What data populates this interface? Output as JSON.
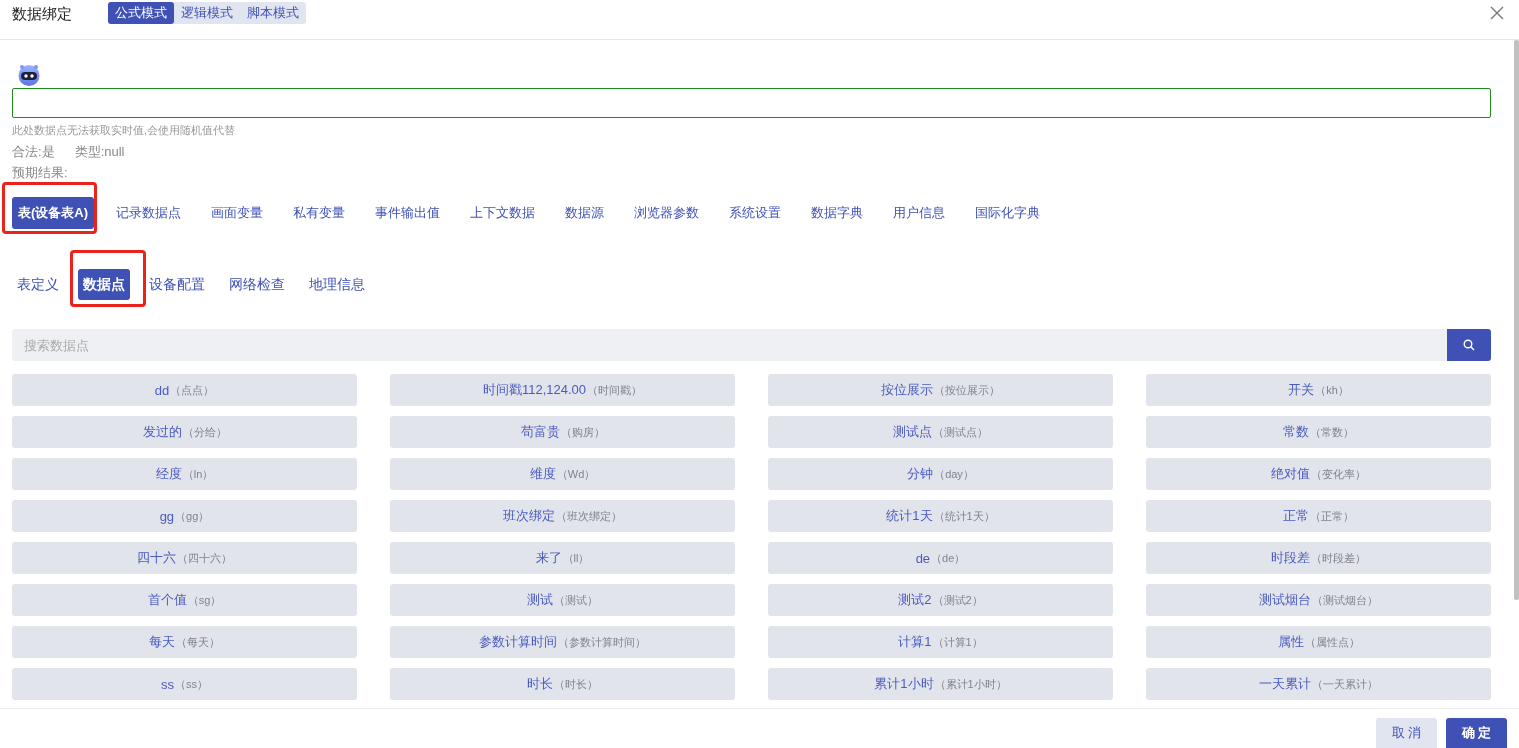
{
  "dialog": {
    "title": "数据绑定"
  },
  "modes": [
    {
      "label": "公式模式",
      "selected": true
    },
    {
      "label": "逻辑模式",
      "selected": false
    },
    {
      "label": "脚本模式",
      "selected": false
    }
  ],
  "hint": "此处数据点无法获取实时值,会使用随机值代替",
  "check": {
    "legal": "合法:是",
    "type": "类型:null"
  },
  "expected_result": "预期结果:",
  "source_tabs": [
    {
      "label": "表(设备表A)",
      "selected": true,
      "highlighted": true
    },
    {
      "label": "记录数据点",
      "selected": false,
      "highlighted": false
    },
    {
      "label": "画面变量",
      "selected": false,
      "highlighted": false
    },
    {
      "label": "私有变量",
      "selected": false,
      "highlighted": false
    },
    {
      "label": "事件输出值",
      "selected": false,
      "highlighted": false
    },
    {
      "label": "上下文数据",
      "selected": false,
      "highlighted": false
    },
    {
      "label": "数据源",
      "selected": false,
      "highlighted": false
    },
    {
      "label": "浏览器参数",
      "selected": false,
      "highlighted": false
    },
    {
      "label": "系统设置",
      "selected": false,
      "highlighted": false
    },
    {
      "label": "数据字典",
      "selected": false,
      "highlighted": false
    },
    {
      "label": "用户信息",
      "selected": false,
      "highlighted": false
    },
    {
      "label": "国际化字典",
      "selected": false,
      "highlighted": false
    }
  ],
  "sub_tabs": [
    {
      "label": "表定义",
      "selected": false,
      "highlighted": false
    },
    {
      "label": "数据点",
      "selected": true,
      "highlighted": true
    },
    {
      "label": "设备配置",
      "selected": false,
      "highlighted": false
    },
    {
      "label": "网络检查",
      "selected": false,
      "highlighted": false
    },
    {
      "label": "地理信息",
      "selected": false,
      "highlighted": false
    }
  ],
  "search": {
    "placeholder": "搜索数据点"
  },
  "data_points": [
    {
      "name": "dd",
      "alias": "（点点）"
    },
    {
      "name": "时间戳112,124.00",
      "alias": "（时间戳）"
    },
    {
      "name": "按位展示",
      "alias": "（按位展示）"
    },
    {
      "name": "开关",
      "alias": "（kh）"
    },
    {
      "name": "发过的",
      "alias": "（分给）"
    },
    {
      "name": "苟富贵",
      "alias": "（购房）"
    },
    {
      "name": "测试点",
      "alias": "（测试点）"
    },
    {
      "name": "常数",
      "alias": "（常数）"
    },
    {
      "name": "经度",
      "alias": "（ln）"
    },
    {
      "name": "维度",
      "alias": "（Wd）"
    },
    {
      "name": "分钟",
      "alias": "（day）"
    },
    {
      "name": "绝对值",
      "alias": "（变化率）"
    },
    {
      "name": "gg",
      "alias": "（gg）"
    },
    {
      "name": "班次绑定",
      "alias": "（班次绑定）"
    },
    {
      "name": "统计1天",
      "alias": "（统计1天）"
    },
    {
      "name": "正常",
      "alias": "（正常）"
    },
    {
      "name": "四十六",
      "alias": "（四十六）"
    },
    {
      "name": "来了",
      "alias": "（ll）"
    },
    {
      "name": "de",
      "alias": "（de）"
    },
    {
      "name": "时段差",
      "alias": "（时段差）"
    },
    {
      "name": "首个值",
      "alias": "（sg）"
    },
    {
      "name": "测试",
      "alias": "（测试）"
    },
    {
      "name": "测试2",
      "alias": "（测试2）"
    },
    {
      "name": "测试烟台",
      "alias": "（测试烟台）"
    },
    {
      "name": "每天",
      "alias": "（每天）"
    },
    {
      "name": "参数计算时间",
      "alias": "（参数计算时间）"
    },
    {
      "name": "计算1",
      "alias": "（计算1）"
    },
    {
      "name": "属性",
      "alias": "（属性点）"
    },
    {
      "name": "ss",
      "alias": "（ss）"
    },
    {
      "name": "时长",
      "alias": "（时长）"
    },
    {
      "name": "累计1小时",
      "alias": "（累计1小时）"
    },
    {
      "name": "一天累计",
      "alias": "（一天累计）"
    }
  ],
  "buttons": [
    {
      "label": "取 消",
      "kind": "secondary"
    },
    {
      "label": "确 定",
      "kind": "primary"
    }
  ]
}
